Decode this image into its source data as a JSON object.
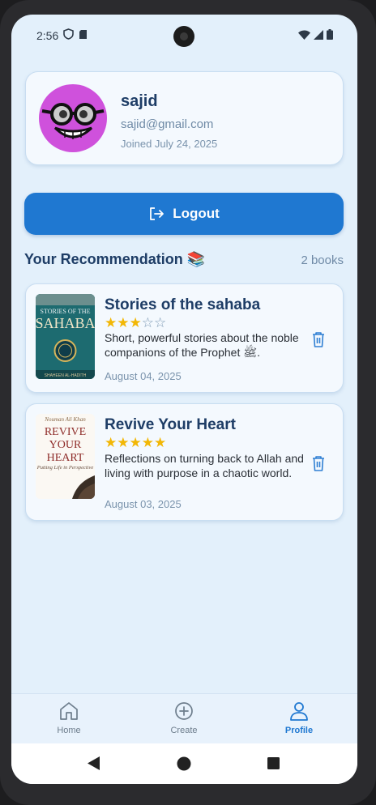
{
  "status": {
    "time": "2:56"
  },
  "profile": {
    "name": "sajid",
    "email": "sajid@gmail.com",
    "joined": "Joined July 24, 2025"
  },
  "logout_label": "Logout",
  "section": {
    "title": "Your Recommendation 📚",
    "count": "2 books"
  },
  "books": [
    {
      "title": "Stories of the sahaba",
      "rating": 3,
      "max_rating": 5,
      "description": "Short, powerful stories about the noble companions of the Prophet ﷺ.",
      "date": "August 04, 2025",
      "cover": {
        "line1": "STORIES OF THE",
        "line2": "SAHABA",
        "author": "SHAHEEN AL-HADITH"
      }
    },
    {
      "title": "Revive Your Heart",
      "rating": 5,
      "max_rating": 5,
      "description": "Reflections on turning back to Allah and living with purpose in a chaotic world.",
      "date": "August 03, 2025",
      "cover": {
        "author": "Nouman Ali Khan",
        "line1": "REVIVE",
        "line2": "YOUR",
        "line3": "HEART",
        "subtitle": "Putting Life in Perspective"
      }
    }
  ],
  "nav": [
    {
      "label": "Home",
      "icon": "home-icon"
    },
    {
      "label": "Create",
      "icon": "plus-circle-icon"
    },
    {
      "label": "Profile",
      "icon": "user-icon",
      "active": true
    }
  ],
  "colors": {
    "accent": "#1f78d1",
    "title": "#1e3d66",
    "star": "#f2b705",
    "avatar_bg": "#cf51dc"
  }
}
